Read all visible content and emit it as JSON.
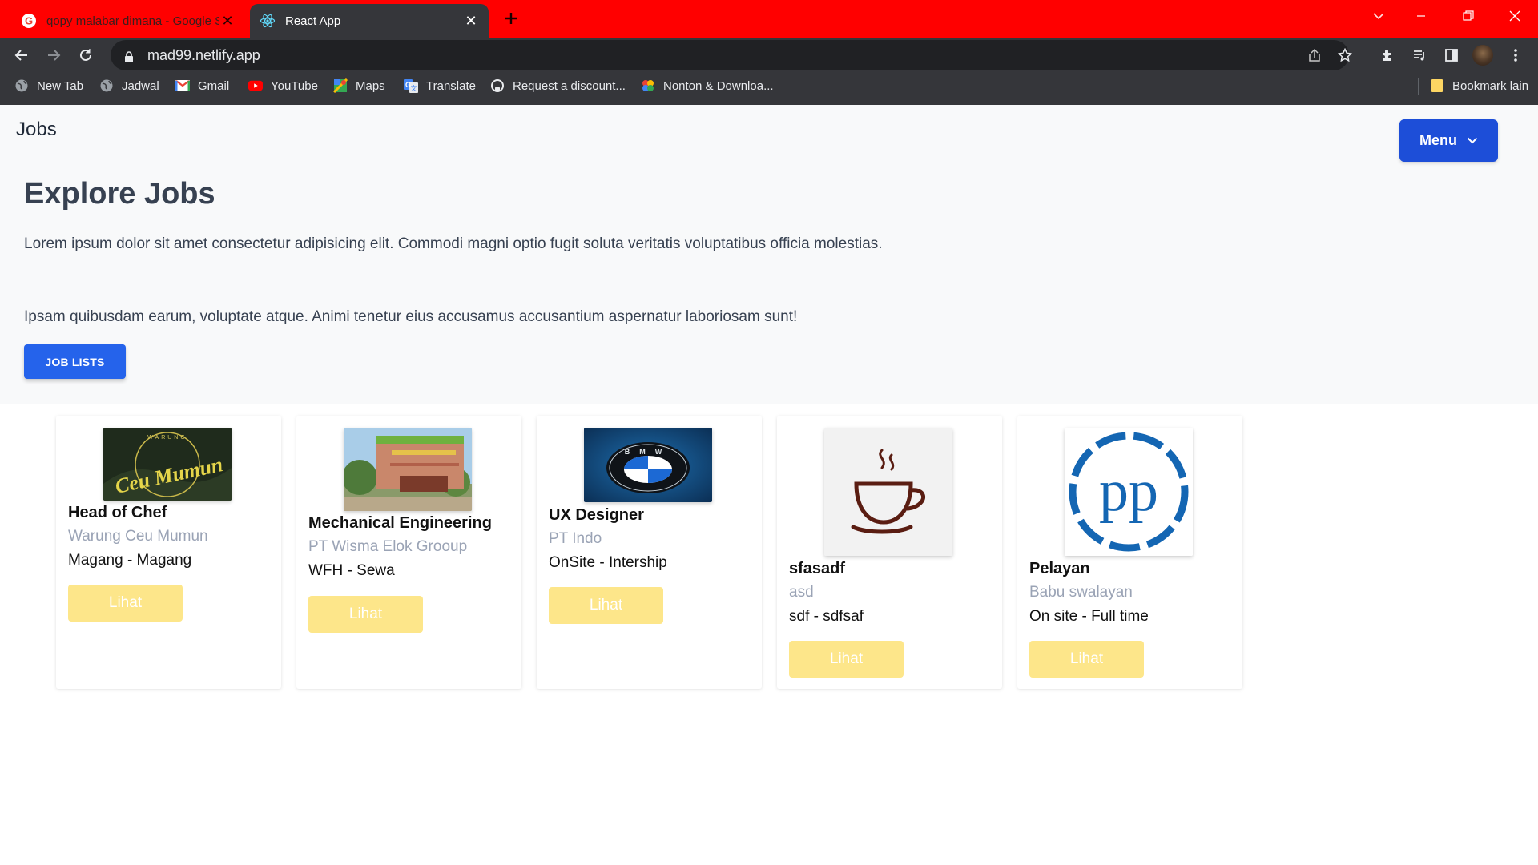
{
  "browser": {
    "tabs": [
      {
        "title": "qopy malabar dimana - Google S",
        "active": false
      },
      {
        "title": "React App",
        "active": true
      }
    ],
    "url": "mad99.netlify.app",
    "bookmarks": [
      {
        "label": "New Tab",
        "icon": "globe-icon"
      },
      {
        "label": "Jadwal",
        "icon": "globe-icon"
      },
      {
        "label": "Gmail",
        "icon": "gmail-icon"
      },
      {
        "label": "YouTube",
        "icon": "youtube-icon"
      },
      {
        "label": "Maps",
        "icon": "maps-icon"
      },
      {
        "label": "Translate",
        "icon": "translate-icon"
      },
      {
        "label": "Request a discount...",
        "icon": "github-icon"
      },
      {
        "label": "Nonton & Downloa...",
        "icon": "colorful-icon"
      }
    ],
    "other_bookmarks": "Bookmark lain"
  },
  "header": {
    "brand": "Jobs",
    "menu_label": "Menu"
  },
  "hero": {
    "title": "Explore Jobs",
    "lead": "Lorem ipsum dolor sit amet consectetur adipisicing elit. Commodi magni optio fugit soluta veritatis voluptatibus officia molestias.",
    "sub": "Ipsam quibusdam earum, voluptate atque. Animi tenetur eius accusamus accusantium aspernatur laboriosam sunt!",
    "button": "JOB LISTS"
  },
  "jobs": [
    {
      "title": "Head of Chef",
      "company": "Warung Ceu Mumun",
      "type": "Magang - Magang",
      "button": "Lihat",
      "logo_text": "Ceu Mumun",
      "logo_top_text": "WARUNG"
    },
    {
      "title": "Mechanical Engineering",
      "company": "PT Wisma Elok Grooup",
      "type": "WFH - Sewa",
      "button": "Lihat"
    },
    {
      "title": "UX Designer",
      "company": "PT Indo",
      "type": "OnSite - Intership",
      "button": "Lihat",
      "logo_text": "BMW"
    },
    {
      "title": "sfasadf",
      "company": "asd",
      "type": "sdf - sdfsaf",
      "button": "Lihat"
    },
    {
      "title": "Pelayan",
      "company": "Babu swalayan",
      "type": "On site - Full time",
      "button": "Lihat",
      "logo_text": "pp"
    }
  ],
  "colors": {
    "tabbar": "#ff0000",
    "menu_button": "#1d4ed8",
    "job_lists_button": "#2563eb",
    "lihat_button": "#fde68a"
  }
}
